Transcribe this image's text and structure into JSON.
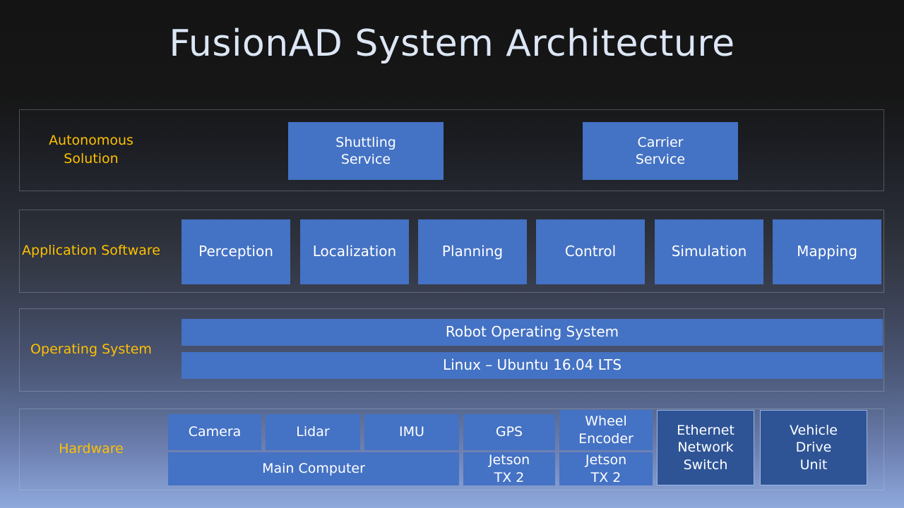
{
  "slide": {
    "title": "FusionAD System Architecture"
  },
  "colors": {
    "accent_label": "#FFC000",
    "box_blue": "#4472C4",
    "box_blue_dark": "#2E5496",
    "title_text": "#DCE6F5",
    "box_text": "#FFFFFF"
  },
  "layers": [
    {
      "id": "autonomous-solution",
      "label": "Autonomous\nSolution",
      "boxes": [
        {
          "id": "shuttling-service",
          "label": "Shuttling\nService",
          "style": "blue"
        },
        {
          "id": "carrier-service",
          "label": "Carrier\nService",
          "style": "blue"
        }
      ]
    },
    {
      "id": "application-software",
      "label": "Application\nSoftware",
      "boxes": [
        {
          "id": "perception",
          "label": "Perception",
          "style": "blue"
        },
        {
          "id": "localization",
          "label": "Localization",
          "style": "blue"
        },
        {
          "id": "planning",
          "label": "Planning",
          "style": "blue"
        },
        {
          "id": "control",
          "label": "Control",
          "style": "blue"
        },
        {
          "id": "simulation",
          "label": "Simulation",
          "style": "blue"
        },
        {
          "id": "mapping",
          "label": "Mapping",
          "style": "blue"
        }
      ]
    },
    {
      "id": "operating-system",
      "label": "Operating\nSystem",
      "boxes": [
        {
          "id": "ros",
          "label": "Robot Operating System",
          "style": "blue"
        },
        {
          "id": "linux",
          "label": "Linux – Ubuntu 16.04 LTS",
          "style": "blue"
        }
      ]
    },
    {
      "id": "hardware",
      "label": "Hardware",
      "boxes": [
        {
          "id": "camera",
          "label": "Camera",
          "style": "blue"
        },
        {
          "id": "main-computer",
          "label": "Main Computer",
          "style": "blue"
        },
        {
          "id": "lidar",
          "label": "Lidar",
          "style": "blue"
        },
        {
          "id": "imu",
          "label": "IMU",
          "style": "blue"
        },
        {
          "id": "gps",
          "label": "GPS",
          "style": "blue"
        },
        {
          "id": "jetson-tx2-gps",
          "label": "Jetson\nTX 2",
          "style": "blue"
        },
        {
          "id": "wheel-encoder",
          "label": "Wheel\nEncoder",
          "style": "blue"
        },
        {
          "id": "jetson-tx2-wheel",
          "label": "Jetson\nTX 2",
          "style": "blue"
        },
        {
          "id": "ethernet-network-switch",
          "label": "Ethernet\nNetwork\nSwitch",
          "style": "blue-dark"
        },
        {
          "id": "vehicle-drive-unit",
          "label": "Vehicle\nDrive\nUnit",
          "style": "blue-dark"
        }
      ]
    }
  ]
}
